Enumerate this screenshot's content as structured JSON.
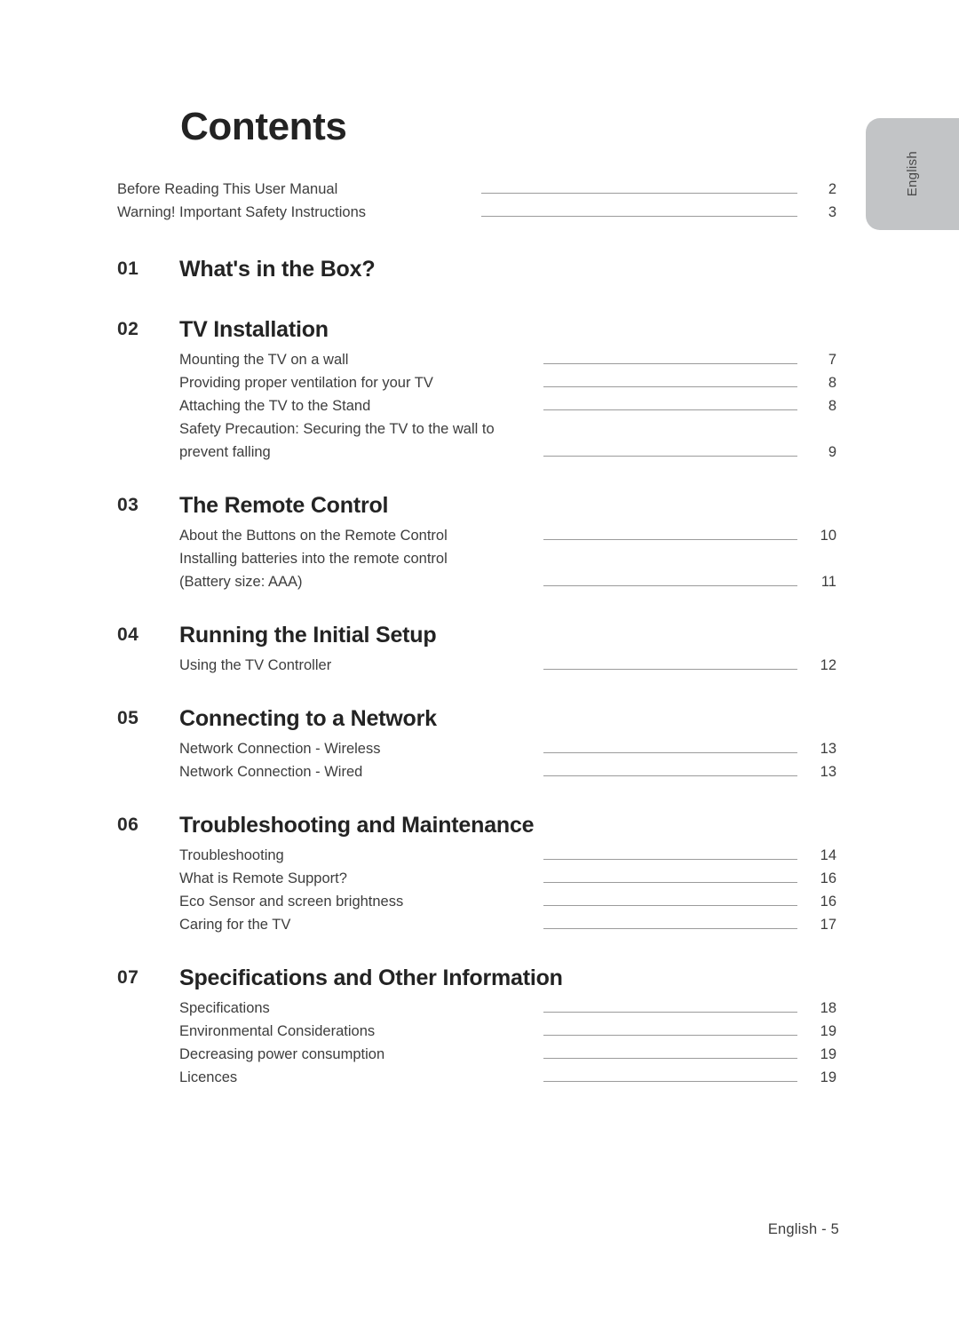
{
  "page": {
    "title": "Contents",
    "footer": "English - 5",
    "language_tab": "English"
  },
  "preamble": [
    {
      "label": "Before Reading This User Manual",
      "page": "2",
      "leader": true
    },
    {
      "label": "Warning! Important Safety Instructions",
      "page": "3",
      "leader": true
    }
  ],
  "sections": [
    {
      "number": "01",
      "title": "What's in the Box?",
      "entries": []
    },
    {
      "number": "02",
      "title": "TV Installation",
      "entries": [
        {
          "label": "Mounting the TV on a wall",
          "page": "7",
          "leader": true
        },
        {
          "label": "Providing proper ventilation for your TV",
          "page": "8",
          "leader": true
        },
        {
          "label": "Attaching the TV to the Stand",
          "page": "8",
          "leader": true
        },
        {
          "label": "Safety Precaution: Securing the TV to the wall to",
          "page": "",
          "leader": false
        },
        {
          "label": "prevent falling",
          "page": "9",
          "leader": true
        }
      ]
    },
    {
      "number": "03",
      "title": "The Remote Control",
      "entries": [
        {
          "label": "About the Buttons on the Remote Control",
          "page": "10",
          "leader": true
        },
        {
          "label": "Installing batteries into the remote control",
          "page": "",
          "leader": false
        },
        {
          "label": "(Battery size: AAA)",
          "page": "11",
          "leader": true
        }
      ]
    },
    {
      "number": "04",
      "title": "Running the Initial Setup",
      "entries": [
        {
          "label": "Using the TV Controller",
          "page": "12",
          "leader": true
        }
      ]
    },
    {
      "number": "05",
      "title": "Connecting to a Network",
      "entries": [
        {
          "label": "Network Connection - Wireless",
          "page": "13",
          "leader": true
        },
        {
          "label": "Network Connection - Wired",
          "page": "13",
          "leader": true
        }
      ]
    },
    {
      "number": "06",
      "title": "Troubleshooting and Maintenance",
      "entries": [
        {
          "label": "Troubleshooting",
          "page": "14",
          "leader": true
        },
        {
          "label": "What is Remote Support?",
          "page": "16",
          "leader": true
        },
        {
          "label": "Eco Sensor and screen brightness",
          "page": "16",
          "leader": true
        },
        {
          "label": "Caring for the TV",
          "page": "17",
          "leader": true
        }
      ]
    },
    {
      "number": "07",
      "title": "Specifications and Other Information",
      "entries": [
        {
          "label": "Specifications",
          "page": "18",
          "leader": true
        },
        {
          "label": "Environmental Considerations",
          "page": "19",
          "leader": true
        },
        {
          "label": "Decreasing power consumption",
          "page": "19",
          "leader": true
        },
        {
          "label": "Licences",
          "page": "19",
          "leader": true
        }
      ]
    }
  ]
}
